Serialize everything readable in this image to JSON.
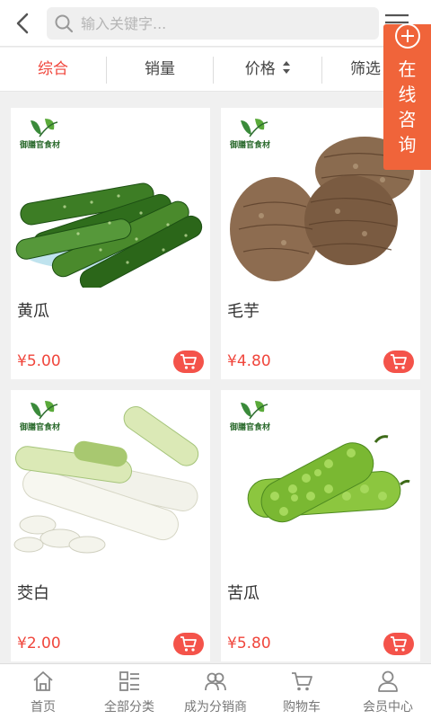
{
  "header": {
    "search_placeholder": "输入关键字..."
  },
  "sort_tabs": [
    {
      "label": "综合",
      "active": true
    },
    {
      "label": "销量",
      "active": false
    },
    {
      "label": "价格",
      "active": false
    },
    {
      "label": "筛选",
      "active": false
    }
  ],
  "consult": {
    "label": "在线咨询"
  },
  "brand": {
    "text": "御膳官食材"
  },
  "products": [
    {
      "name": "黄瓜",
      "price": "¥5.00",
      "image": "cucumber"
    },
    {
      "name": "毛芋",
      "price": "¥4.80",
      "image": "taro"
    },
    {
      "name": "茭白",
      "price": "¥2.00",
      "image": "water-bamboo"
    },
    {
      "name": "苦瓜",
      "price": "¥5.80",
      "image": "bitter-melon"
    }
  ],
  "bottom_nav": [
    {
      "label": "首页",
      "icon": "home-icon"
    },
    {
      "label": "全部分类",
      "icon": "category-icon"
    },
    {
      "label": "成为分销商",
      "icon": "distributor-icon"
    },
    {
      "label": "购物车",
      "icon": "cart-icon"
    },
    {
      "label": "会员中心",
      "icon": "member-icon"
    }
  ],
  "colors": {
    "accent": "#f0463c",
    "consult": "#f0643a"
  }
}
